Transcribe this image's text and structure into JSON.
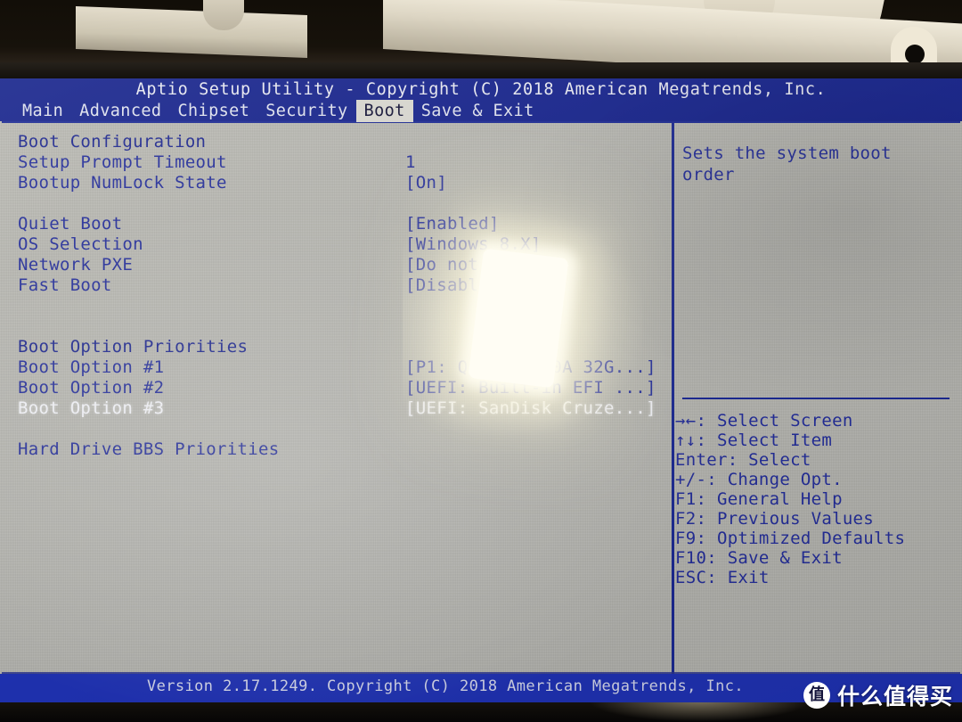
{
  "bios": {
    "title": "Aptio Setup Utility - Copyright (C) 2018 American Megatrends, Inc.",
    "menu": [
      {
        "label": "Main",
        "active": false
      },
      {
        "label": "Advanced",
        "active": false
      },
      {
        "label": "Chipset",
        "active": false
      },
      {
        "label": "Security",
        "active": false
      },
      {
        "label": "Boot",
        "active": true
      },
      {
        "label": "Save & Exit",
        "active": false
      }
    ],
    "settings": [
      {
        "label": "Boot Configuration",
        "value": "",
        "selected": false,
        "header": true
      },
      {
        "label": "Setup Prompt Timeout",
        "value": "1",
        "selected": false,
        "header": false
      },
      {
        "label": "Bootup NumLock State",
        "value": "[On]",
        "selected": false,
        "header": false
      },
      {
        "label": "",
        "value": "",
        "selected": false,
        "header": false
      },
      {
        "label": "Quiet Boot",
        "value": "[Enabled]",
        "selected": false,
        "header": false
      },
      {
        "label": "OS Selection",
        "value": "[Windows 8.X]",
        "selected": false,
        "header": false
      },
      {
        "label": "Network PXE",
        "value": "[Do not Launch]",
        "selected": false,
        "header": false
      },
      {
        "label": "Fast Boot",
        "value": "[Disabled]",
        "selected": false,
        "header": false
      },
      {
        "label": "",
        "value": "",
        "selected": false,
        "header": false
      },
      {
        "label": "",
        "value": "",
        "selected": false,
        "header": false
      },
      {
        "label": "Boot Option Priorities",
        "value": "",
        "selected": false,
        "header": true
      },
      {
        "label": "Boot Option #1",
        "value": "[P1: Qunion P20A 32G...]",
        "selected": false,
        "header": false
      },
      {
        "label": "Boot Option #2",
        "value": "[UEFI: Built-in EFI ...]",
        "selected": false,
        "header": false
      },
      {
        "label": "Boot Option #3",
        "value": "[UEFI: SanDisk Cruze...]",
        "selected": true,
        "header": false
      },
      {
        "label": "",
        "value": "",
        "selected": false,
        "header": false
      },
      {
        "label": "Hard Drive BBS Priorities",
        "value": "",
        "selected": false,
        "header": false
      }
    ],
    "help": "Sets the system boot order",
    "keys": [
      "→←: Select Screen",
      "↑↓: Select Item",
      "Enter: Select",
      "+/-: Change Opt.",
      "F1: General Help",
      "F2: Previous Values",
      "F9: Optimized Defaults",
      "F10: Save & Exit",
      "ESC: Exit"
    ],
    "status": "Version 2.17.1249. Copyright (C) 2018 American Megatrends, Inc."
  },
  "watermark": {
    "badge": "值",
    "text": "什么值得买"
  },
  "colors": {
    "header_blue": "#15228d",
    "status_blue": "#2033b8",
    "screen_bg": "#b9b9b4",
    "text_blue": "#252f9c",
    "selected_text": "#f4f5fb"
  }
}
